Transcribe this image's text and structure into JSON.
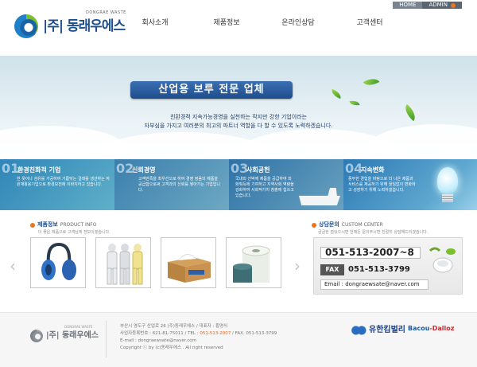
{
  "util_nav": {
    "home": "HOME",
    "admin": "ADMIN"
  },
  "brand": {
    "name": "|주| 동래우에스",
    "sub": "DONGRAE WASTE"
  },
  "gnb": [
    "회사소개",
    "제품정보",
    "온라인상담",
    "고객센터"
  ],
  "hero": {
    "title": "산업용 보루 전문 업체",
    "line1": "친환경적 지속가능경영을 실천하는 작지만 강한 기업이라는",
    "line2": "자부심을 가지고 여러분의 최고의 파트너 역할을 다 할 수 있도록 노력하겠습니다."
  },
  "features": [
    {
      "num": "01",
      "title": "환경친화적 기업",
      "desc": "헌 옷이나 섬유를 가공하여 기름닦는 걸레를 생산하는 자원재활용기업으로 환경보전에 이바지하고 있습니다."
    },
    {
      "num": "02",
      "title": "신뢰경영",
      "desc": "고객만족을 최우선으로 하여 경영 정음의 제품을 공급함으로써 고객과의 신뢰를 쌓아가는 기업입니다."
    },
    {
      "num": "03",
      "title": "사회공헌",
      "desc": "국내외 선박에 제품을 공급하여 외화획득에 기여하고 지역사회 역량을 강화하여 사회적가치 창출에 힘쓰고 있습니다."
    },
    {
      "num": "04",
      "title": "지속변화",
      "desc": "풍부한 경험을 바탕으로 더 나은 제품과 서비스를 제공하기 위해 끊임없이 변화하고 성장하기 위해 노력하겠습니다."
    }
  ],
  "products": {
    "title": "제품정보",
    "subtitle": "PRODUCT INFO",
    "desc": "더 좋은 제품으로 고객님께 전보이겠습니다.",
    "items": [
      "earmuff",
      "protective-suit",
      "wiper-box",
      "oil-absorbent-roll"
    ]
  },
  "custom": {
    "title": "상담문의",
    "subtitle": "CUSTOM CENTER",
    "desc": "궁금한 점있으시면 언제든 문의주시면 친절히 상담해드리겠습니다.",
    "tel": "051-513-2007~8",
    "fax_label": "FAX",
    "fax": "051-513-3799",
    "email": "Email : dongraewsate@naver.com"
  },
  "footer": {
    "logo_name": "|주| 동래우에스",
    "logo_sub": "DONGRAE WASTE",
    "line1": "부산시 영도구 산업로 26  (주)동래우에스 / 대표자 : 황영식",
    "line2_prefix": "사업자등록번호 : 621-81-75011  /  TEL : ",
    "tel": "051-513-2007",
    "line2_suffix": "  /  FAX. 051-513-3799",
    "line3": "E-mail : dongraewsate@naver.com",
    "line4": "Copyright ⓒ by (c)동래우에스 . All right reserved",
    "partner1": "유한킴벌리",
    "partner2_a": "Bacou",
    "partner2_b": "-Dalloz"
  },
  "colors": {
    "accent": "#e8761e",
    "brand": "#1d4f8f"
  }
}
